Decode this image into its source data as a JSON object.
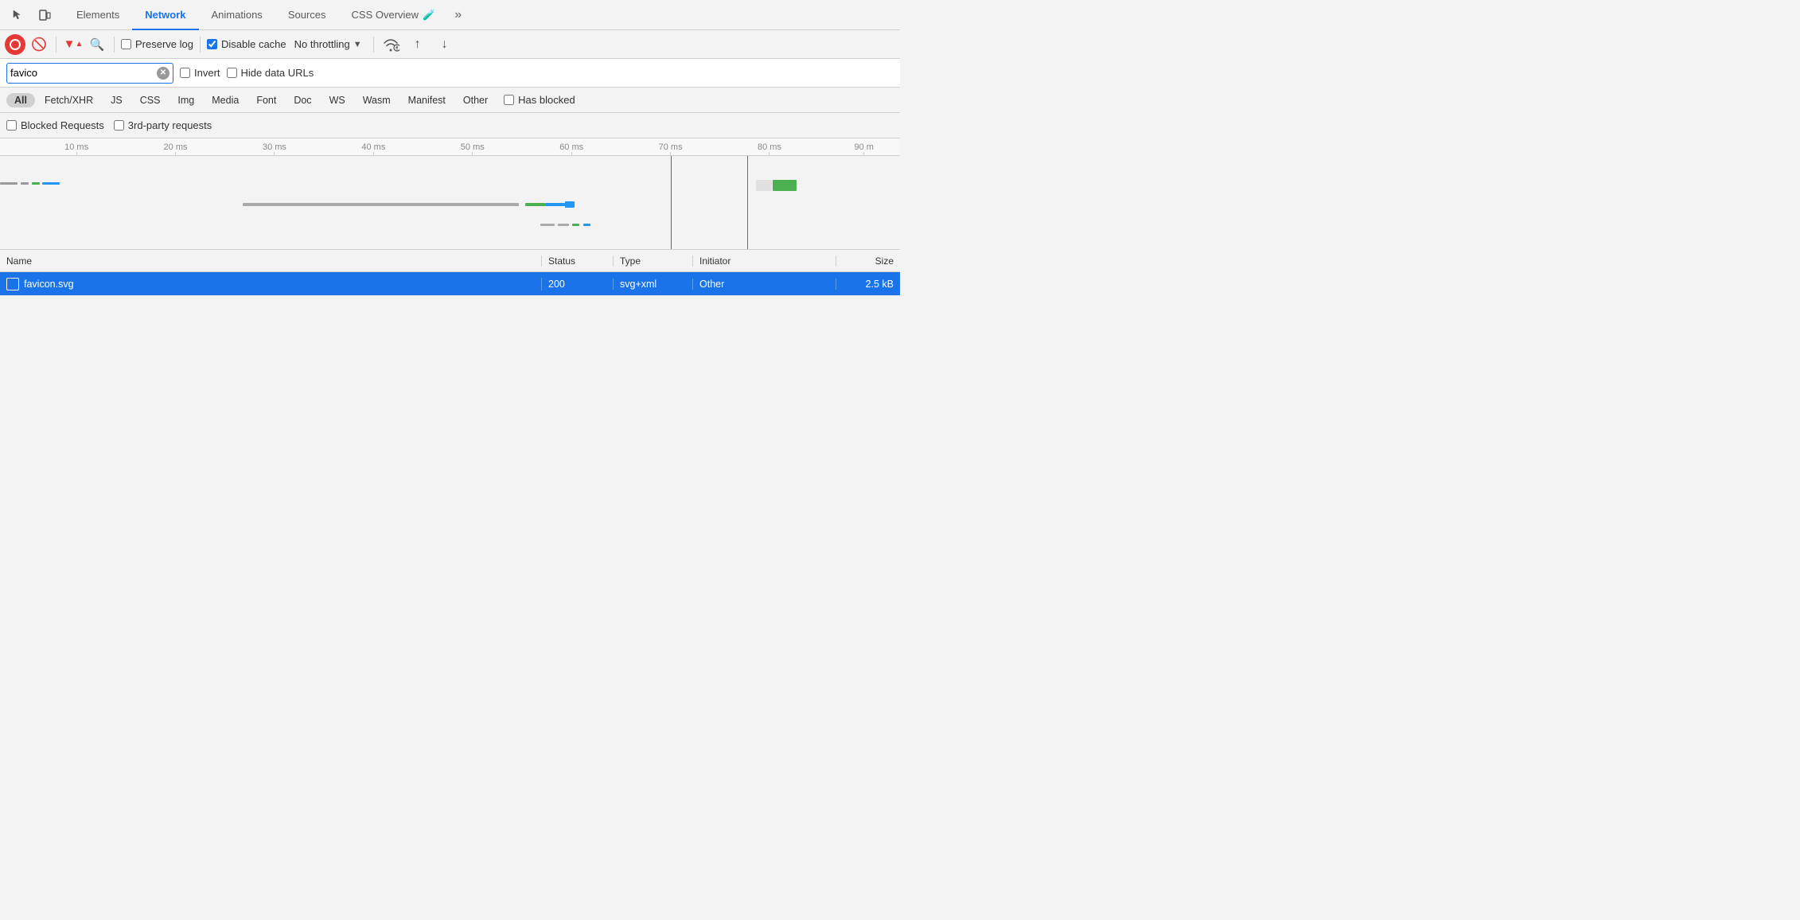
{
  "tabs": {
    "items": [
      {
        "label": "Elements",
        "active": false
      },
      {
        "label": "Network",
        "active": true
      },
      {
        "label": "Animations",
        "active": false
      },
      {
        "label": "Sources",
        "active": false
      },
      {
        "label": "CSS Overview",
        "active": false
      }
    ],
    "more_label": "»"
  },
  "toolbar": {
    "record_title": "Record",
    "clear_title": "Clear",
    "filter_title": "Filter",
    "search_title": "Search",
    "preserve_log_label": "Preserve log",
    "disable_cache_label": "Disable cache",
    "throttle_label": "No throttling",
    "upload_title": "Upload",
    "download_title": "Download"
  },
  "filter": {
    "placeholder": "Filter",
    "search_value": "favico",
    "invert_label": "Invert",
    "hide_data_urls_label": "Hide data URLs"
  },
  "type_filters": {
    "items": [
      {
        "label": "All",
        "active": true
      },
      {
        "label": "Fetch/XHR",
        "active": false
      },
      {
        "label": "JS",
        "active": false
      },
      {
        "label": "CSS",
        "active": false
      },
      {
        "label": "Img",
        "active": false
      },
      {
        "label": "Media",
        "active": false
      },
      {
        "label": "Font",
        "active": false
      },
      {
        "label": "Doc",
        "active": false
      },
      {
        "label": "WS",
        "active": false
      },
      {
        "label": "Wasm",
        "active": false
      },
      {
        "label": "Manifest",
        "active": false
      },
      {
        "label": "Other",
        "active": false
      }
    ],
    "has_blocked_label": "Has blocked"
  },
  "blocked": {
    "blocked_requests_label": "Blocked Requests",
    "third_party_label": "3rd-party requests"
  },
  "ruler": {
    "ticks": [
      "10 ms",
      "20 ms",
      "30 ms",
      "40 ms",
      "50 ms",
      "60 ms",
      "70 ms",
      "80 ms",
      "90 m"
    ]
  },
  "table": {
    "headers": {
      "name": "Name",
      "status": "Status",
      "type": "Type",
      "initiator": "Initiator",
      "size": "Size"
    },
    "rows": [
      {
        "name": "favicon.svg",
        "status": "200",
        "type": "svg+xml",
        "initiator": "Other",
        "size": "2.5 kB",
        "selected": true
      }
    ]
  }
}
